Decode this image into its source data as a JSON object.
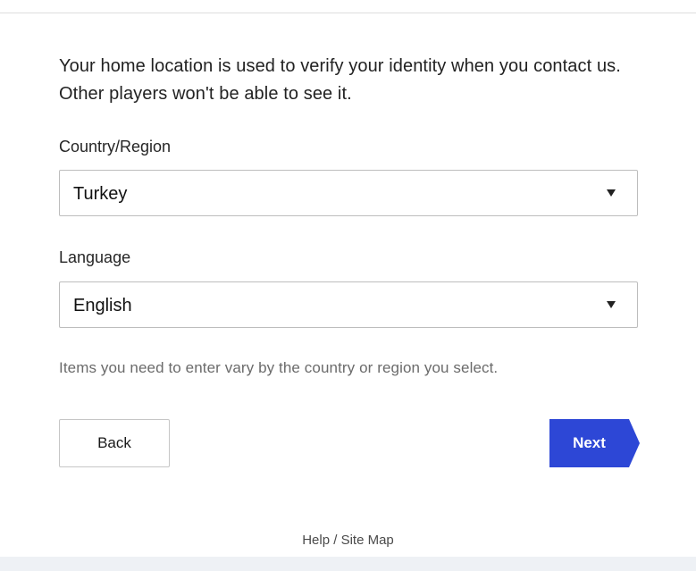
{
  "intro_text": "Your home location is used to verify your identity when you contact us. Other players won't be able to see it.",
  "country": {
    "label": "Country/Region",
    "value": "Turkey"
  },
  "language": {
    "label": "Language",
    "value": "English"
  },
  "hint_text": "Items you need to enter vary by the country or region you select.",
  "buttons": {
    "back": "Back",
    "next": "Next"
  },
  "footer": {
    "link_text": "Help / Site Map"
  },
  "colors": {
    "next_button": "#2d47d6",
    "footer_band": "#eef1f5"
  }
}
